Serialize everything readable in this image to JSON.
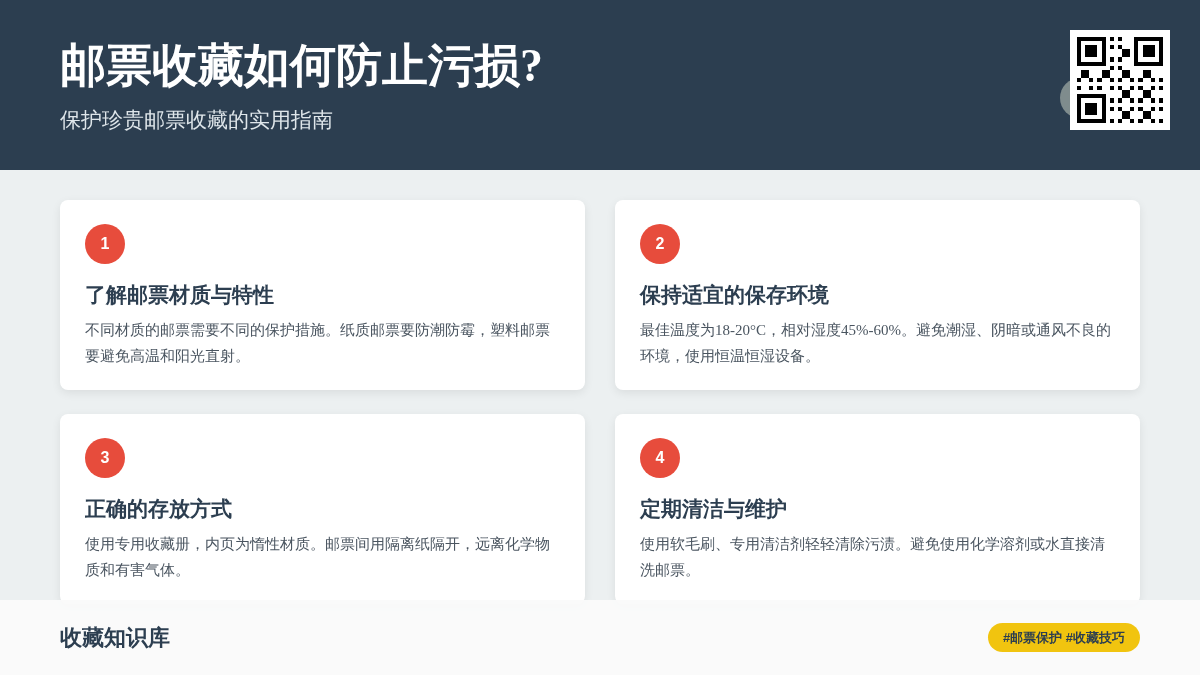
{
  "header": {
    "title": "邮票收藏如何防止污损?",
    "subtitle": "保护珍贵邮票收藏的实用指南"
  },
  "cards": [
    {
      "number": "1",
      "title": "了解邮票材质与特性",
      "text": "不同材质的邮票需要不同的保护措施。纸质邮票要防潮防霉，塑料邮票要避免高温和阳光直射。"
    },
    {
      "number": "2",
      "title": "保持适宜的保存环境",
      "text": "最佳温度为18-20°C，相对湿度45%-60%。避免潮湿、阴暗或通风不良的环境，使用恒温恒湿设备。"
    },
    {
      "number": "3",
      "title": "正确的存放方式",
      "text": "使用专用收藏册，内页为惰性材质。邮票间用隔离纸隔开，远离化学物质和有害气体。"
    },
    {
      "number": "4",
      "title": "定期清洁与维护",
      "text": "使用软毛刷、专用清洁剂轻轻清除污渍。避免使用化学溶剂或水直接清洗邮票。"
    }
  ],
  "footer": {
    "brand": "收藏知识库",
    "tags": "#邮票保护 #收藏技巧"
  }
}
